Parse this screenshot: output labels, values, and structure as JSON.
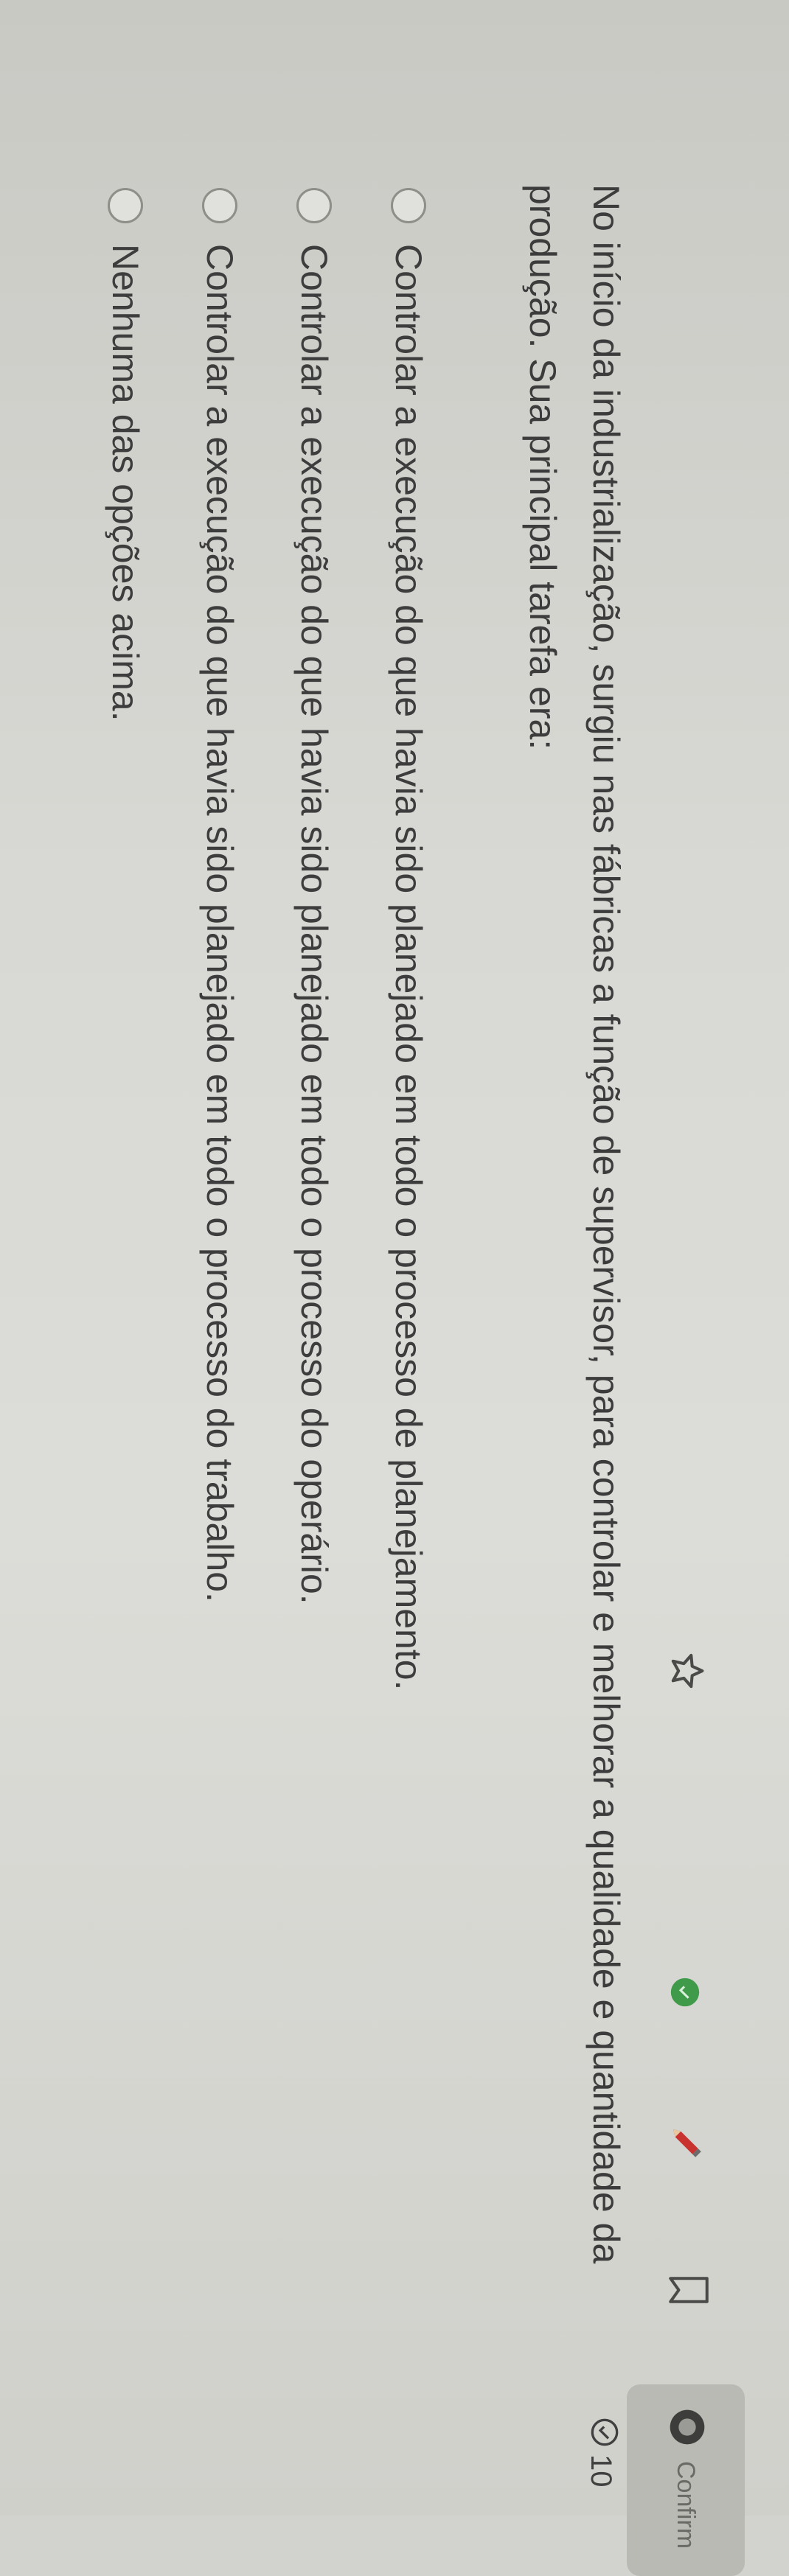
{
  "toolbar": {
    "confirm_label": "Confirm",
    "icons": [
      "star-icon",
      "green-circle-icon",
      "pencil-icon",
      "bookmark-icon",
      "confirm-circle-icon"
    ]
  },
  "timer": {
    "value": "10",
    "icon": "timer-check-icon"
  },
  "question": {
    "text": "No início da industrialização, surgiu nas fábricas a função de supervisor, para controlar e melhorar a qualidade e quantidade da produção. Sua principal tarefa era:"
  },
  "options": [
    {
      "label": "Controlar a execução do que havia sido planejado em todo o processo de planejamento."
    },
    {
      "label": "Controlar a execução do que havia sido planejado em todo o processo do operário."
    },
    {
      "label": "Controlar a execução do que havia sido planejado em todo o processo do trabalho."
    },
    {
      "label": "Nenhuma das opções acima."
    }
  ],
  "colors": {
    "page": "#d6d6d2",
    "text": "#3c3c3c",
    "accent_green": "#3f9a4a",
    "pencil_red": "#c8322f",
    "confirm_bg": "#b9bab4"
  }
}
